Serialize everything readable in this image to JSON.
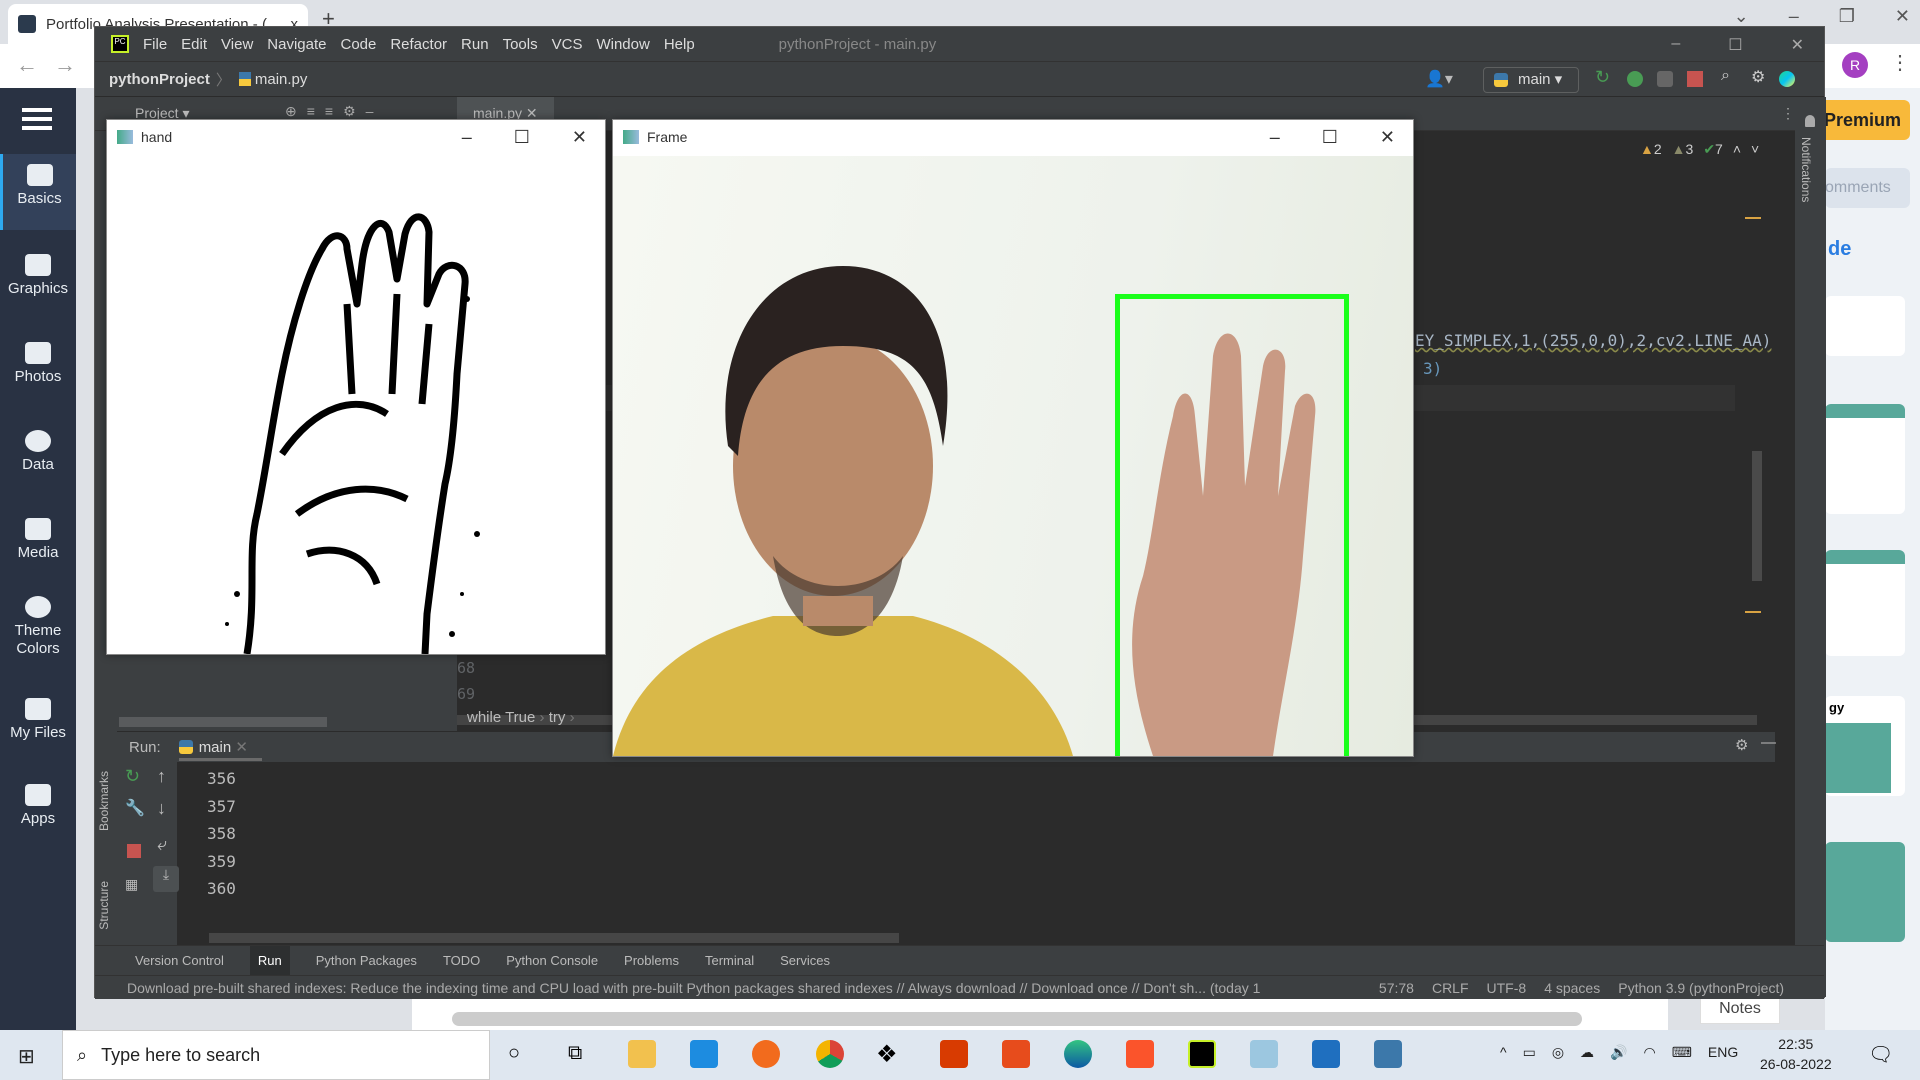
{
  "browser": {
    "tab_title": "Portfolio Analysis Presentation - (",
    "tab_close": "x",
    "new_tab": "+",
    "back": "←",
    "forward": "→",
    "avatar_letter": "R",
    "window_controls": [
      "⌄",
      "–",
      "❐",
      "✕"
    ]
  },
  "visme": {
    "sidebar": [
      {
        "label": "Basics",
        "icon": "abc-blocks-icon",
        "active": true
      },
      {
        "label": "Graphics",
        "icon": "graphics-icon"
      },
      {
        "label": "Photos",
        "icon": "photo-icon"
      },
      {
        "label": "Data",
        "icon": "pie-chart-icon"
      },
      {
        "label": "Media",
        "icon": "media-play-icon"
      },
      {
        "label": "Theme Colors",
        "icon": "palette-icon"
      },
      {
        "label": "My Files",
        "icon": "folder-plus-icon"
      },
      {
        "label": "Apps",
        "icon": "apps-grid-icon"
      }
    ],
    "premium": "Premium",
    "comments": "omments",
    "right_heading_de": "de",
    "right_heading_gy": "gy",
    "notes": "Notes"
  },
  "pycharm": {
    "menu": [
      "File",
      "Edit",
      "View",
      "Navigate",
      "Code",
      "Refactor",
      "Run",
      "Tools",
      "VCS",
      "Window",
      "Help"
    ],
    "window_title": "pythonProject - main.py",
    "breadcrumb_project": "pythonProject",
    "breadcrumb_file": "main.py",
    "run_config": "main",
    "project_tab": "Project",
    "editor_tab": "main.py",
    "inspections": {
      "warnings": "2",
      "weak_warnings": "3",
      "ok": "7"
    },
    "code_line_1": "EY_SIMPLEX,1,(255,0,0),2,cv2.LINE_AA)",
    "code_line_2": "3)",
    "line_numbers": [
      "68",
      "69"
    ],
    "code_breadcrumbs": [
      "while True",
      "try"
    ],
    "notifications_label": "Notifications",
    "bookmarks_label": "Bookmarks",
    "structure_label": "Structure",
    "run_label": "Run:",
    "run_tab": "main",
    "output_lines": [
      "356",
      "357",
      "358",
      "359",
      "360"
    ],
    "bottom_tabs": [
      "Version Control",
      "Run",
      "Python Packages",
      "TODO",
      "Python Console",
      "Problems",
      "Terminal",
      "Services"
    ],
    "status_message": "Download pre-built shared indexes: Reduce the indexing time and CPU load with pre-built Python packages shared indexes // Always download // Download once // Don't sh... (today 1",
    "status_position": "57:78",
    "status_line_sep": "CRLF",
    "status_encoding": "UTF-8",
    "status_indent": "4 spaces",
    "status_interpreter": "Python 3.9 (pythonProject)"
  },
  "cv_windows": {
    "hand_title": "hand",
    "frame_title": "Frame",
    "controls": [
      "–",
      "☐",
      "✕"
    ],
    "roi_box_color": "#1aff1a"
  },
  "taskbar": {
    "search_placeholder": "Type here to search",
    "language": "ENG",
    "time": "22:35",
    "date": "26-08-2022"
  }
}
